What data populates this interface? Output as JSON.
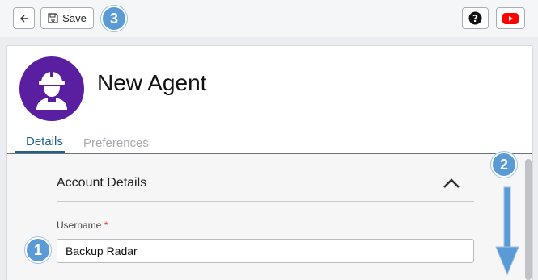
{
  "toolbar": {
    "back_icon": "arrow-left-icon",
    "save_label": "Save",
    "save_icon": "floppy-disk-icon",
    "help_icon": "question-circle-icon",
    "video_icon": "youtube-icon"
  },
  "callouts": {
    "one": "1",
    "two": "2",
    "three": "3"
  },
  "agent": {
    "title": "New Agent",
    "avatar_icon": "worker-hardhat-icon"
  },
  "tabs": [
    {
      "label": "Details",
      "active": true
    },
    {
      "label": "Preferences",
      "active": false
    }
  ],
  "account_details": {
    "section_title": "Account Details",
    "collapse_icon": "chevron-up-icon",
    "username_label": "Username",
    "required_marker": "*",
    "username_value": "Backup Radar"
  },
  "colors": {
    "avatar": "#5a1ea0",
    "accent": "#1d5f8f",
    "callout": "#5b9bd5",
    "youtube": "#ff0000"
  }
}
